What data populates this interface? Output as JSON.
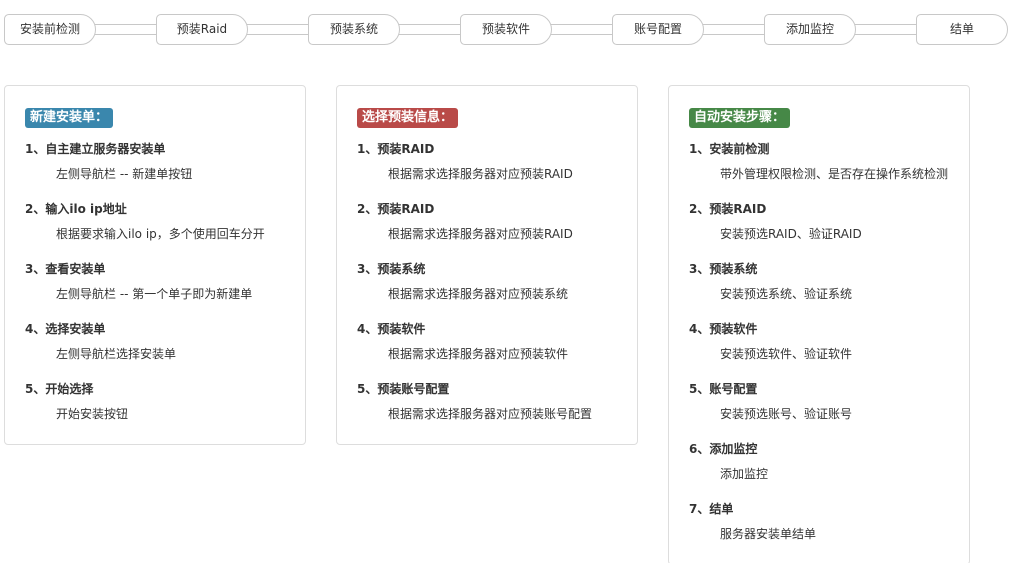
{
  "steps": [
    "安装前检测",
    "预装Raid",
    "预装系统",
    "预装软件",
    "账号配置",
    "添加监控",
    "结单"
  ],
  "colors": {
    "blue": "#3a87ad",
    "red": "#b94a48",
    "green": "#468847"
  },
  "panels": [
    {
      "title": "新建安装单：",
      "items": [
        {
          "title": "1、自主建立服务器安装单",
          "desc": "左侧导航栏 -- 新建单按钮"
        },
        {
          "title": "2、输入ilo ip地址",
          "desc": "根据要求输入ilo ip，多个使用回车分开"
        },
        {
          "title": "3、查看安装单",
          "desc": "左侧导航栏 -- 第一个单子即为新建单"
        },
        {
          "title": "4、选择安装单",
          "desc": "左侧导航栏选择安装单"
        },
        {
          "title": "5、开始选择",
          "desc": "开始安装按钮"
        }
      ]
    },
    {
      "title": "选择预装信息：",
      "items": [
        {
          "title": "1、预装RAID",
          "desc": "根据需求选择服务器对应预装RAID"
        },
        {
          "title": "2、预装RAID",
          "desc": "根据需求选择服务器对应预装RAID"
        },
        {
          "title": "3、预装系统",
          "desc": "根据需求选择服务器对应预装系统"
        },
        {
          "title": "4、预装软件",
          "desc": "根据需求选择服务器对应预装软件"
        },
        {
          "title": "5、预装账号配置",
          "desc": "根据需求选择服务器对应预装账号配置"
        }
      ]
    },
    {
      "title": "自动安装步骤：",
      "items": [
        {
          "title": "1、安装前检测",
          "desc": "带外管理权限检测、是否存在操作系统检测"
        },
        {
          "title": "2、预装RAID",
          "desc": "安装预选RAID、验证RAID"
        },
        {
          "title": "3、预装系统",
          "desc": "安装预选系统、验证系统"
        },
        {
          "title": "4、预装软件",
          "desc": "安装预选软件、验证软件"
        },
        {
          "title": "5、账号配置",
          "desc": "安装预选账号、验证账号"
        },
        {
          "title": "6、添加监控",
          "desc": "添加监控"
        },
        {
          "title": "7、结单",
          "desc": "服务器安装单结单"
        }
      ]
    }
  ]
}
